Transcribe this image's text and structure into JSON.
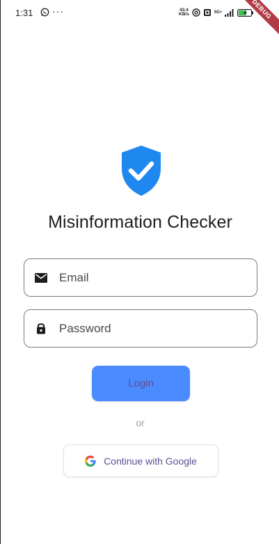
{
  "status_bar": {
    "time": "1:31",
    "more": "···",
    "net_speed_value": "43.4",
    "net_speed_unit": "KB/s",
    "network_type": "5G+",
    "battery_percent": "65",
    "icons": [
      "whatsapp-icon",
      "hotspot-icon",
      "data-saver-icon",
      "signal-icon",
      "battery-charging-icon"
    ]
  },
  "debug_banner": "DEBUG",
  "app": {
    "title": "Misinformation Checker",
    "logo_icon": "shield-check-icon",
    "accent_color": "#1f88ef"
  },
  "form": {
    "email": {
      "placeholder": "Email",
      "value": "",
      "icon": "email-icon"
    },
    "password": {
      "placeholder": "Password",
      "value": "",
      "icon": "lock-icon"
    },
    "login_label": "Login",
    "login_color": "#4a8cff",
    "divider_text": "or",
    "google_label": "Continue with Google",
    "google_icon": "google-icon"
  }
}
